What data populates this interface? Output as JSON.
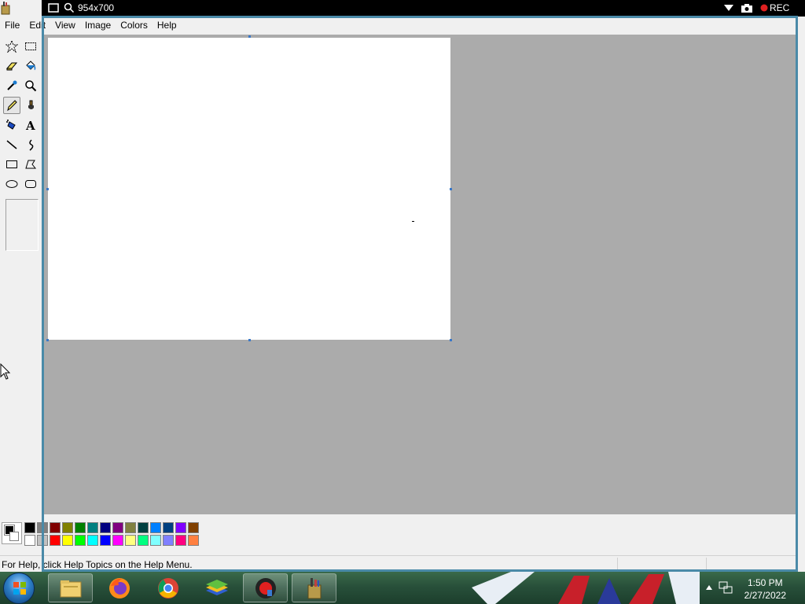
{
  "recorder": {
    "size_label": "954x700",
    "rec_label": "REC",
    "rec_color": "#e02020",
    "frame_color": "#4a8aa8"
  },
  "menu": {
    "items": [
      "File",
      "Edit",
      "View",
      "Image",
      "Colors",
      "Help"
    ]
  },
  "tools": [
    {
      "name": "free-form-select-tool",
      "icon": "star-select-icon"
    },
    {
      "name": "select-tool",
      "icon": "rect-select-icon"
    },
    {
      "name": "eraser-tool",
      "icon": "eraser-icon"
    },
    {
      "name": "fill-tool",
      "icon": "bucket-icon"
    },
    {
      "name": "pick-color-tool",
      "icon": "eyedropper-icon"
    },
    {
      "name": "magnifier-tool",
      "icon": "magnifier-icon"
    },
    {
      "name": "pencil-tool",
      "icon": "pencil-icon"
    },
    {
      "name": "brush-tool",
      "icon": "brush-icon"
    },
    {
      "name": "airbrush-tool",
      "icon": "airbrush-icon"
    },
    {
      "name": "text-tool",
      "icon": "text-icon"
    },
    {
      "name": "line-tool",
      "icon": "line-icon"
    },
    {
      "name": "curve-tool",
      "icon": "curve-icon"
    },
    {
      "name": "rectangle-tool",
      "icon": "rectangle-icon"
    },
    {
      "name": "polygon-tool",
      "icon": "polygon-icon"
    },
    {
      "name": "ellipse-tool",
      "icon": "ellipse-icon"
    },
    {
      "name": "rounded-rectangle-tool",
      "icon": "rounded-rectangle-icon"
    }
  ],
  "active_tool": "pencil-tool",
  "palette": {
    "foreground": "#000000",
    "background": "#ffffff",
    "row1": [
      "#000000",
      "#808080",
      "#800000",
      "#808000",
      "#008000",
      "#008080",
      "#000080",
      "#800080",
      "#808040",
      "#004040",
      "#0080ff",
      "#004080",
      "#8000ff",
      "#804000"
    ],
    "row2": [
      "#ffffff",
      "#c0c0c0",
      "#ff0000",
      "#ffff00",
      "#00ff00",
      "#00ffff",
      "#0000ff",
      "#ff00ff",
      "#ffff80",
      "#00ff80",
      "#80ffff",
      "#8080ff",
      "#ff0080",
      "#ff8040"
    ]
  },
  "status": {
    "help_text": "For Help, click Help Topics on the Help Menu."
  },
  "taskbar": {
    "apps": [
      "file-explorer",
      "firefox",
      "chrome",
      "bluestacks",
      "screen-recorder",
      "paint"
    ],
    "time": "1:50 PM",
    "date": "2/27/2022"
  },
  "colors": {
    "workspace": "#ababab",
    "canvas": "#ffffff",
    "handle": "#3a78c8"
  }
}
